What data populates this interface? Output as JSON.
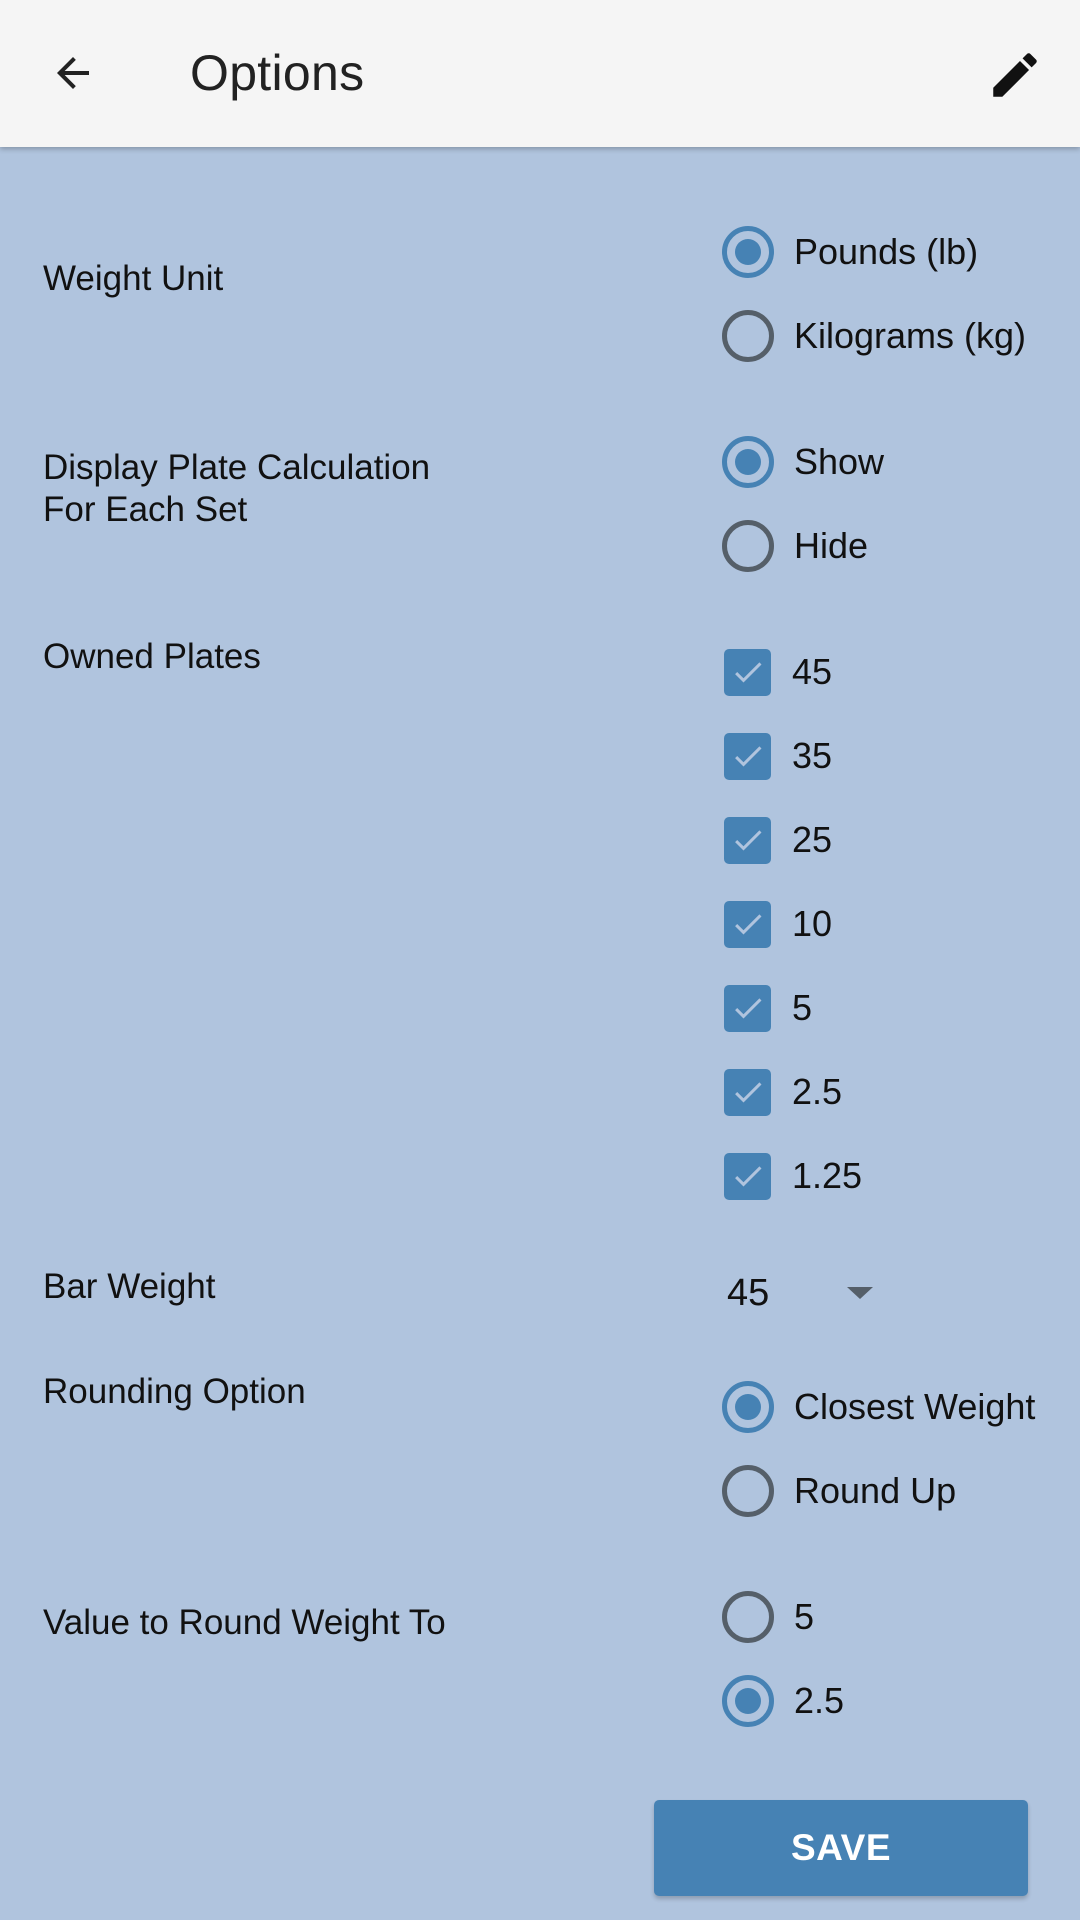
{
  "appbar": {
    "title": "Options",
    "back_icon": "arrow-back-icon",
    "edit_icon": "pencil-icon"
  },
  "colors": {
    "accent": "#4682b4",
    "background": "#b0c4de",
    "appbar": "#f5f5f5",
    "radio_off": "#555f69"
  },
  "weight_unit": {
    "label": "Weight Unit",
    "options": [
      {
        "label": "Pounds (lb)",
        "selected": true
      },
      {
        "label": "Kilograms (kg)",
        "selected": false
      }
    ]
  },
  "plate_calc": {
    "label_line1": "Display Plate Calculation",
    "label_line2": "For Each Set",
    "options": [
      {
        "label": "Show",
        "selected": true
      },
      {
        "label": "Hide",
        "selected": false
      }
    ]
  },
  "owned_plates": {
    "label": "Owned Plates",
    "items": [
      {
        "label": "45",
        "checked": true
      },
      {
        "label": "35",
        "checked": true
      },
      {
        "label": "25",
        "checked": true
      },
      {
        "label": "10",
        "checked": true
      },
      {
        "label": "5",
        "checked": true
      },
      {
        "label": "2.5",
        "checked": true
      },
      {
        "label": "1.25",
        "checked": true
      }
    ]
  },
  "bar_weight": {
    "label": "Bar Weight",
    "value": "45"
  },
  "rounding_option": {
    "label": "Rounding Option",
    "options": [
      {
        "label": "Closest Weight",
        "selected": true
      },
      {
        "label": "Round Up",
        "selected": false
      }
    ]
  },
  "round_to": {
    "label": "Value to Round Weight To",
    "options": [
      {
        "label": "5",
        "selected": false
      },
      {
        "label": "2.5",
        "selected": true
      }
    ]
  },
  "save_label": "SAVE"
}
